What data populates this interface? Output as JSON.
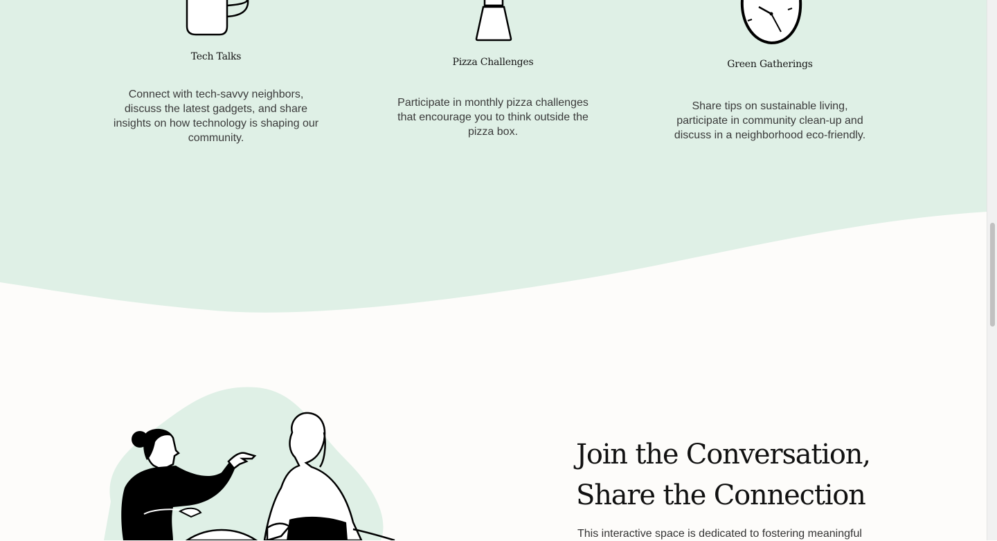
{
  "features": [
    {
      "title": "Tech Talks",
      "desc": "Connect with tech-savvy neighbors, discuss the latest gadgets, and share insights on how technology is shaping our community.",
      "icon": "mug-icon"
    },
    {
      "title": "Pizza Challenges",
      "desc": "Participate in monthly pizza challenges that encourage you to think outside the pizza box.",
      "icon": "jar-icon"
    },
    {
      "title": "Green Gatherings",
      "desc": "Share tips on sustainable living, participate in community clean-up and discuss in a neighborhood eco-friendly.",
      "icon": "clock-icon"
    }
  ],
  "conversation": {
    "heading_line1": "Join the Conversation,",
    "heading_line2": "Share the Connection",
    "lead": "This interactive space is dedicated to fostering meaningful"
  },
  "colors": {
    "mint": "#dff0e6",
    "accent": "#1b6b63",
    "background": "#fdfcfa"
  }
}
